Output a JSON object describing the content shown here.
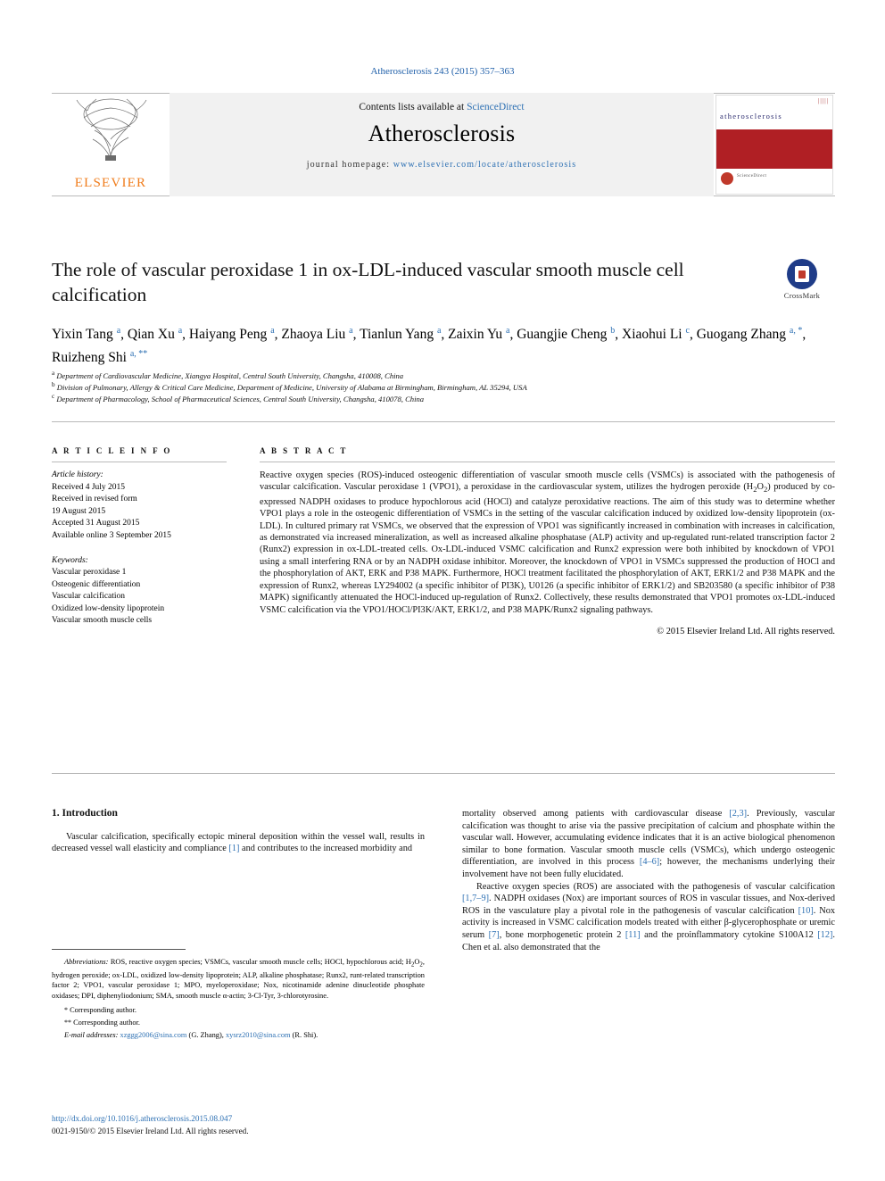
{
  "journal_ref": "Atherosclerosis 243 (2015) 357–363",
  "header": {
    "contents_prefix": "Contents lists available at ",
    "contents_link": "ScienceDirect",
    "journal_name": "Atherosclerosis",
    "homepage_label": "journal homepage: ",
    "homepage_url": "www.elsevier.com/locate/atherosclerosis",
    "publisher": "ELSEVIER",
    "cover_title": "atherosclerosis",
    "cover_bars": "|||||",
    "cover_tiny": "ScienceDirect"
  },
  "crossmark": {
    "label": "CrossMark"
  },
  "title": "The role of vascular peroxidase 1 in ox-LDL-induced vascular smooth muscle cell calcification",
  "authors_html": "Yixin Tang <sup>a</sup>, Qian Xu <sup>a</sup>, Haiyang Peng <sup>a</sup>, Zhaoya Liu <sup>a</sup>, Tianlun Yang <sup>a</sup>, Zaixin Yu <sup>a</sup>, Guangjie Cheng <sup>b</sup>, Xiaohui Li <sup>c</sup>, Guogang Zhang <sup>a, *</sup>, Ruizheng Shi <sup>a, **</sup>",
  "affiliations": [
    "Department of Cardiovascular Medicine, Xiangya Hospital, Central South University, Changsha, 410008, China",
    "Division of Pulmonary, Allergy & Critical Care Medicine, Department of Medicine, University of Alabama at Birmingham, Birmingham, AL 35294, USA",
    "Department of Pharmacology, School of Pharmaceutical Sciences, Central South University, Changsha, 410078, China"
  ],
  "affiliation_marks": [
    "a",
    "b",
    "c"
  ],
  "article_info": {
    "heading": "A R T I C L E   I N F O",
    "history_label": "Article history:",
    "history": [
      "Received 4 July 2015",
      "Received in revised form",
      "19 August 2015",
      "Accepted 31 August 2015",
      "Available online 3 September 2015"
    ],
    "keywords_label": "Keywords:",
    "keywords": [
      "Vascular peroxidase 1",
      "Osteogenic differentiation",
      "Vascular calcification",
      "Oxidized low-density lipoprotein",
      "Vascular smooth muscle cells"
    ]
  },
  "abstract": {
    "heading": "A B S T R A C T",
    "text": "Reactive oxygen species (ROS)-induced osteogenic differentiation of vascular smooth muscle cells (VSMCs) is associated with the pathogenesis of vascular calcification. Vascular peroxidase 1 (VPO1), a peroxidase in the cardiovascular system, utilizes the hydrogen peroxide (H2O2) produced by co-expressed NADPH oxidases to produce hypochlorous acid (HOCl) and catalyze peroxidative reactions. The aim of this study was to determine whether VPO1 plays a role in the osteogenic differentiation of VSMCs in the setting of the vascular calcification induced by oxidized low-density lipoprotein (ox-LDL). In cultured primary rat VSMCs, we observed that the expression of VPO1 was significantly increased in combination with increases in calcification, as demonstrated via increased mineralization, as well as increased alkaline phosphatase (ALP) activity and up-regulated runt-related transcription factor 2 (Runx2) expression in ox-LDL-treated cells. Ox-LDL-induced VSMC calcification and Runx2 expression were both inhibited by knockdown of VPO1 using a small interfering RNA or by an NADPH oxidase inhibitor. Moreover, the knockdown of VPO1 in VSMCs suppressed the production of HOCl and the phosphorylation of AKT, ERK and P38 MAPK. Furthermore, HOCl treatment facilitated the phosphorylation of AKT, ERK1/2 and P38 MAPK and the expression of Runx2, whereas LY294002 (a specific inhibitor of PI3K), U0126 (a specific inhibitor of ERK1/2) and SB203580 (a specific inhibitor of P38 MAPK) significantly attenuated the HOCl-induced up-regulation of Runx2. Collectively, these results demonstrated that VPO1 promotes ox-LDL-induced VSMC calcification via the VPO1/HOCl/PI3K/AKT, ERK1/2, and P38 MAPK/Runx2 signaling pathways.",
    "copyright": "© 2015 Elsevier Ireland Ltd. All rights reserved."
  },
  "body": {
    "section_number_title": "1.   Introduction",
    "left_paragraph": "Vascular calcification, specifically ectopic mineral deposition within the vessel wall, results in decreased vessel wall elasticity and compliance [1] and contributes to the increased morbidity and",
    "right_paragraphs": [
      "mortality observed among patients with cardiovascular disease [2,3]. Previously, vascular calcification was thought to arise via the passive precipitation of calcium and phosphate within the vascular wall. However, accumulating evidence indicates that it is an active biological phenomenon similar to bone formation. Vascular smooth muscle cells (VSMCs), which undergo osteogenic differentiation, are involved in this process [4–6]; however, the mechanisms underlying their involvement have not been fully elucidated.",
      "Reactive oxygen species (ROS) are associated with the pathogenesis of vascular calcification [1,7–9]. NADPH oxidases (Nox) are important sources of ROS in vascular tissues, and Nox-derived ROS in the vasculature play a pivotal role in the pathogenesis of vascular calcification [10]. Nox activity is increased in VSMC calcification models treated with either β-glycerophosphate or uremic serum [7], bone morphogenetic protein 2 [11] and the proinflammatory cytokine S100A12 [12]. Chen et al. also demonstrated that the"
    ]
  },
  "footnotes": {
    "abbreviations_label": "Abbreviations:",
    "abbreviations_text": "ROS, reactive oxygen species; VSMCs, vascular smooth muscle cells; HOCl, hypochlorous acid; H2O2, hydrogen peroxide; ox-LDL, oxidized low-density lipoprotein; ALP, alkaline phosphatase; Runx2, runt-related transcription factor 2; VPO1, vascular peroxidase 1; MPO, myeloperoxidase; Nox, nicotinamide adenine dinucleotide phosphate oxidases; DPI, diphenyliodonium; SMA, smooth muscle α-actin; 3-Cl-Tyr, 3-chlorotyrosine.",
    "corresponding_1": "Corresponding author.",
    "corresponding_2": "Corresponding author.",
    "email_label": "E-mail addresses:",
    "email_1": "xzggg2006@sina.com",
    "email_1_name": "(G. Zhang)",
    "email_2": "xysrz2010@sina.com",
    "email_2_name": "(R. Shi)."
  },
  "doi": "http://dx.doi.org/10.1016/j.atherosclerosis.2015.08.047",
  "issn": "0021-9150/© 2015 Elsevier Ireland Ltd. All rights reserved.",
  "colors": {
    "link": "#2d70b3",
    "elsevier_orange": "#f07c1b",
    "cover_red": "#b01f24"
  }
}
